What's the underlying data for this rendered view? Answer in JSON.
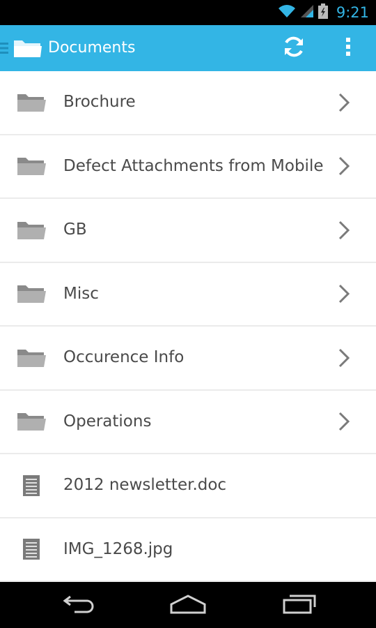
{
  "status_bar": {
    "time": "9:21"
  },
  "action_bar": {
    "title": "Documents",
    "icons": {
      "drawer": "drawer-indicator-icon",
      "app": "folder-icon",
      "refresh": "refresh-icon",
      "overflow": "overflow-menu-icon"
    },
    "accent_color": "#33b5e5"
  },
  "items": [
    {
      "label": "Brochure",
      "type": "folder"
    },
    {
      "label": "Defect Attachments from Mobile",
      "type": "folder"
    },
    {
      "label": "GB",
      "type": "folder"
    },
    {
      "label": "Misc",
      "type": "folder"
    },
    {
      "label": "Occurence Info",
      "type": "folder"
    },
    {
      "label": "Operations",
      "type": "folder"
    },
    {
      "label": "2012 newsletter.doc",
      "type": "file"
    },
    {
      "label": "IMG_1268.jpg",
      "type": "file"
    }
  ],
  "nav_bar": {
    "icons": [
      "back-icon",
      "home-icon",
      "recent-apps-icon"
    ]
  }
}
